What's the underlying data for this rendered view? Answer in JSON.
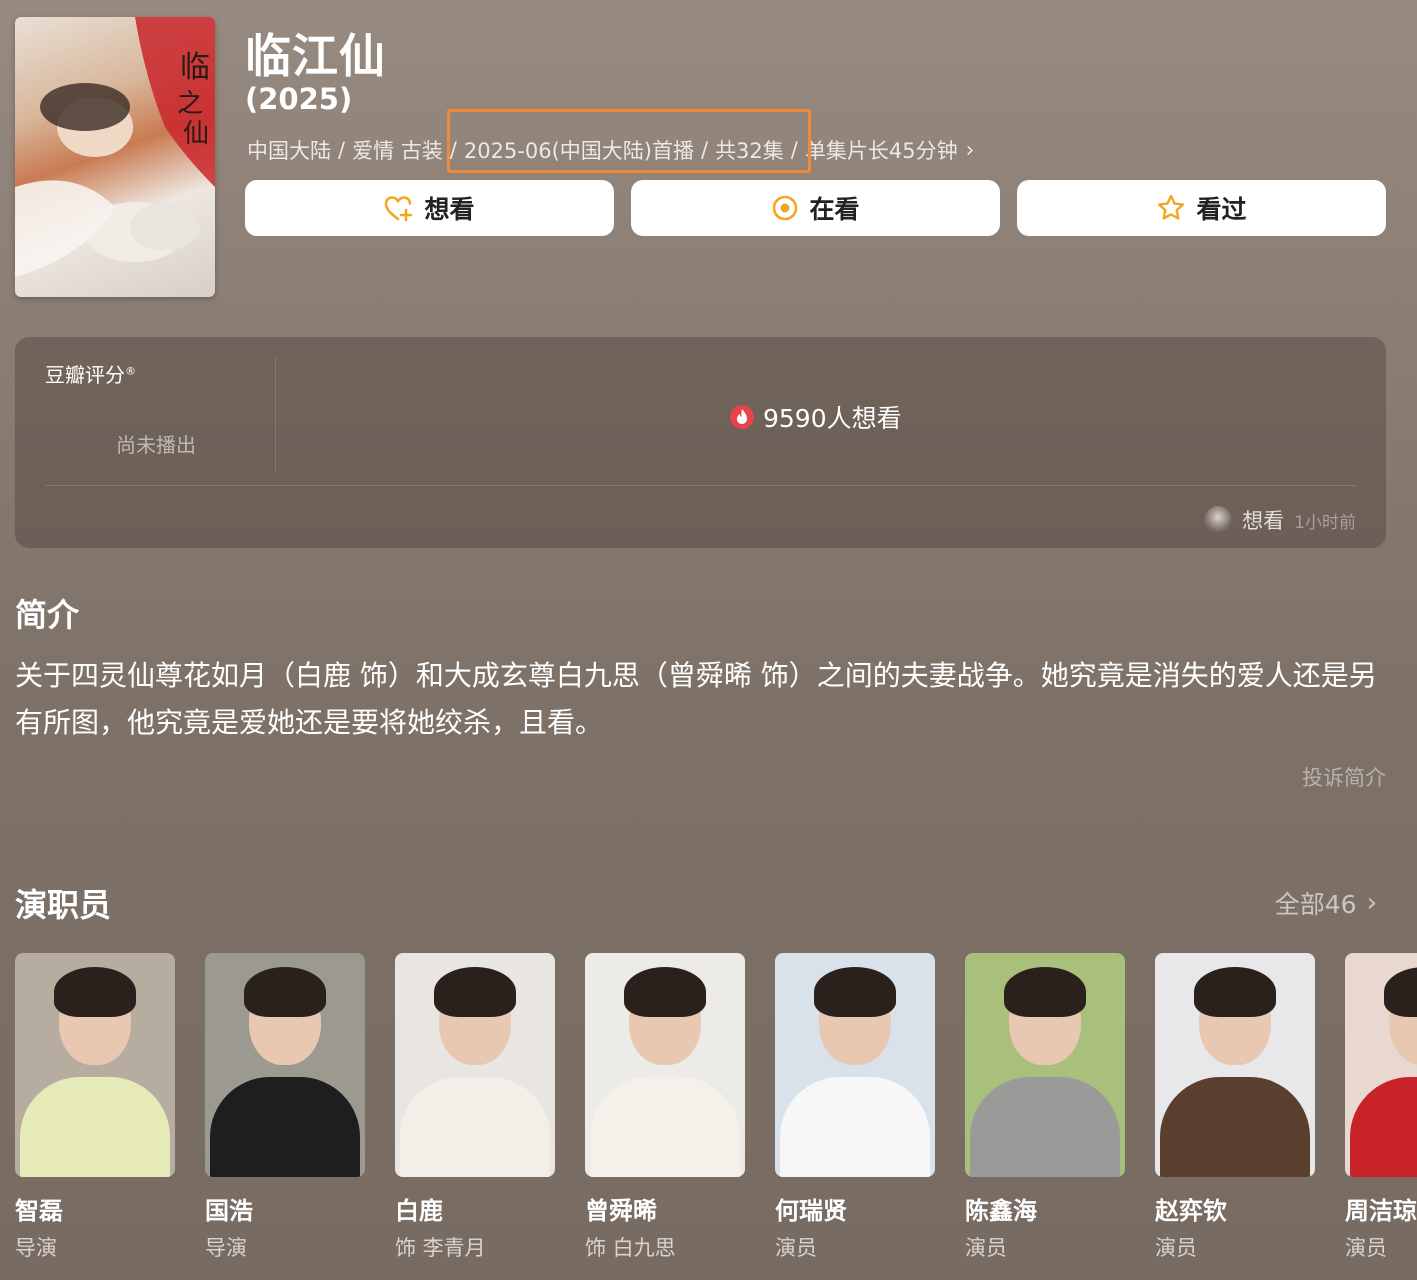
{
  "show": {
    "title": "临江仙",
    "year": "(2025)",
    "meta": {
      "region": "中国大陆",
      "genres": "爱情 古装",
      "premiere": "2025-06(中国大陆)首播",
      "episodes": "共32集",
      "duration": "单集片长45分钟",
      "separator": "/"
    }
  },
  "actions": {
    "want": "想看",
    "watching": "在看",
    "watched": "看过"
  },
  "rating": {
    "label": "豆瓣评分",
    "mark": "®",
    "status": "尚未播出",
    "want_count": "9590人想看",
    "activity_action": "想看",
    "activity_time": "1小时前"
  },
  "intro": {
    "heading": "简介",
    "text": "关于四灵仙尊花如月（白鹿 饰）和大成玄尊白九思（曾舜晞 饰）之间的夫妻战争。她究竟是消失的爱人还是另有所图，他究竟是爱她还是要将她绞杀，且看。",
    "complain": "投诉简介"
  },
  "cast": {
    "heading": "演职员",
    "all_label": "全部46",
    "members": [
      {
        "name": "智磊",
        "role": "导演",
        "bg": "#b7aca0",
        "body": "#e6e9b8"
      },
      {
        "name": "国浩",
        "role": "导演",
        "bg": "#9c9a90",
        "body": "#1e1e1e"
      },
      {
        "name": "白鹿",
        "role": "饰 李青月",
        "bg": "#e9e6e2",
        "body": "#f3efe8"
      },
      {
        "name": "曾舜晞",
        "role": "饰 白九思",
        "bg": "#ecebe8",
        "body": "#f4f1ea"
      },
      {
        "name": "何瑞贤",
        "role": "演员",
        "bg": "#d9e2ea",
        "body": "#f7f7f7"
      },
      {
        "name": "陈鑫海",
        "role": "演员",
        "bg": "#a9c07c",
        "body": "#9a9a98"
      },
      {
        "name": "赵弈钦",
        "role": "演员",
        "bg": "#e8e8ea",
        "body": "#5a3e2e"
      },
      {
        "name": "周洁琼",
        "role": "演员",
        "bg": "#e8d8d0",
        "body": "#c8222a"
      }
    ]
  },
  "colors": {
    "highlight_box": "#f08a3a",
    "action_icon": "#f5a524",
    "fire_badge": "#e8434a"
  },
  "icons": {
    "want": "heart-plus-icon",
    "watching": "target-circle-icon",
    "watched": "star-outline-icon",
    "fire": "fire-icon",
    "chevron": "chevron-right-icon"
  }
}
